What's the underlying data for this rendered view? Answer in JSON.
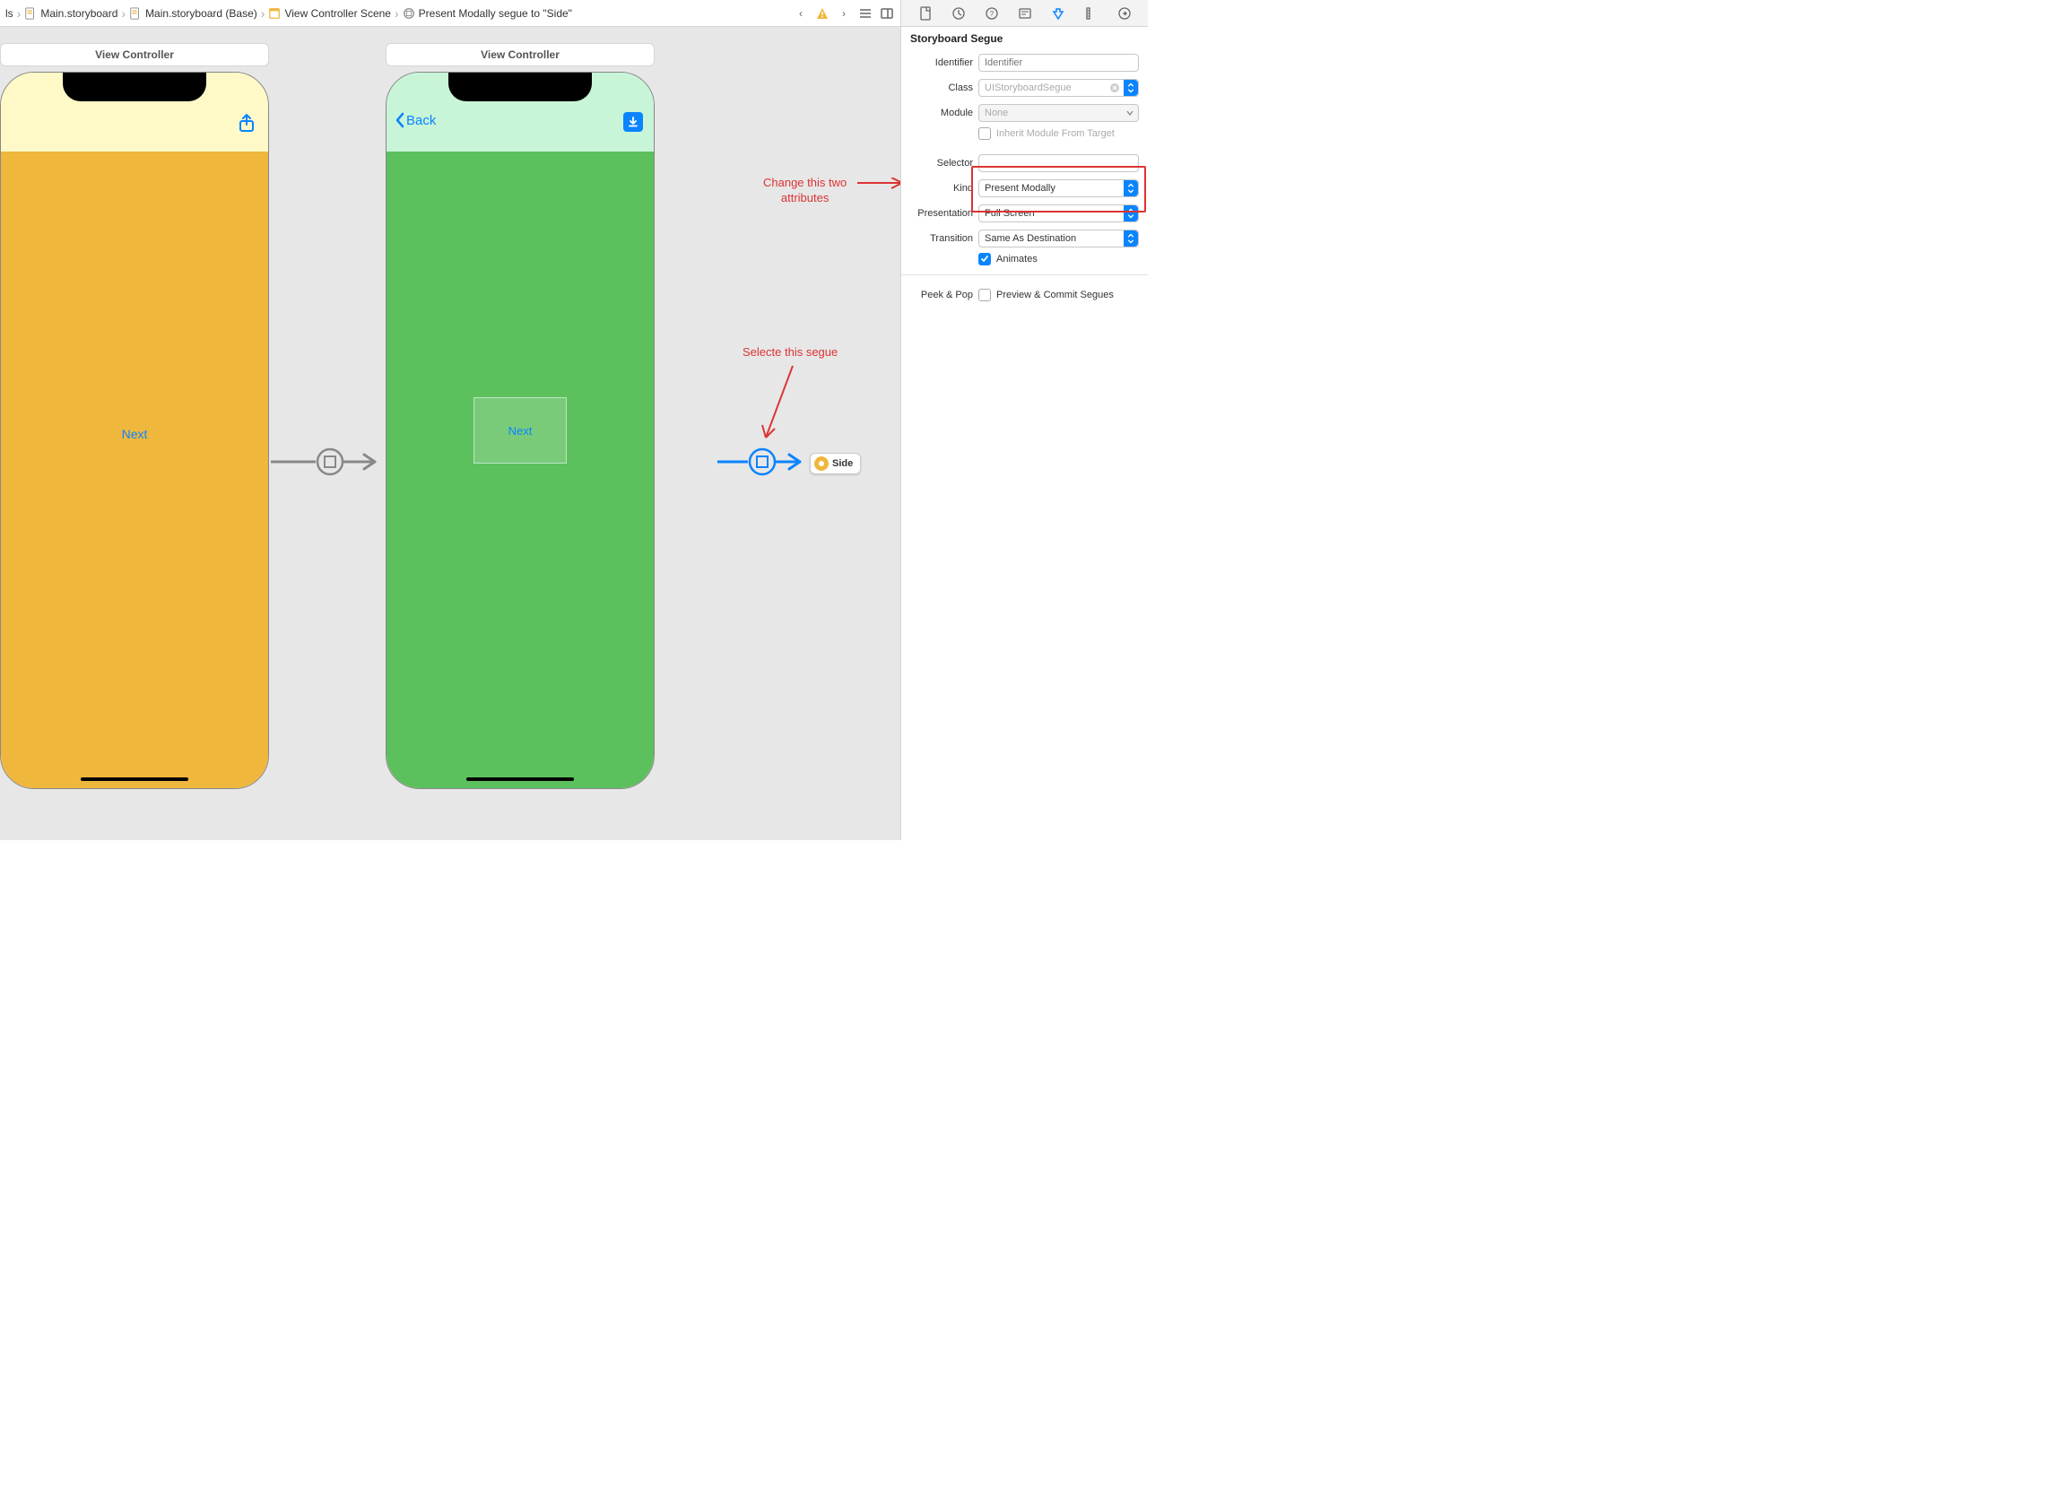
{
  "breadcrumb": {
    "items": [
      {
        "label": "ls"
      },
      {
        "label": "Main.storyboard"
      },
      {
        "label": "Main.storyboard (Base)"
      },
      {
        "label": "View Controller Scene"
      },
      {
        "label": "Present Modally segue to \"Side\""
      }
    ]
  },
  "scenes": {
    "left": {
      "title": "View Controller",
      "button": "Next"
    },
    "right": {
      "title": "View Controller",
      "back": "Back",
      "container_label": "Next"
    }
  },
  "side_node": {
    "label": "Side"
  },
  "annotations": {
    "select_segue": "Selecte this segue",
    "change_attrs_l1": "Change this two",
    "change_attrs_l2": "attributes"
  },
  "inspector": {
    "heading": "Storyboard Segue",
    "identifier_label": "Identifier",
    "identifier_placeholder": "Identifier",
    "class_label": "Class",
    "class_value": "UIStoryboardSegue",
    "module_label": "Module",
    "module_value": "None",
    "inherit_label": "Inherit Module From Target",
    "selector_label": "Selector",
    "kind_label": "Kind",
    "kind_value": "Present Modally",
    "presentation_label": "Presentation",
    "presentation_value": "Full Screen",
    "transition_label": "Transition",
    "transition_value": "Same As Destination",
    "animates_label": "Animates",
    "peekpop_label": "Peek & Pop",
    "preview_label": "Preview & Commit Segues"
  }
}
